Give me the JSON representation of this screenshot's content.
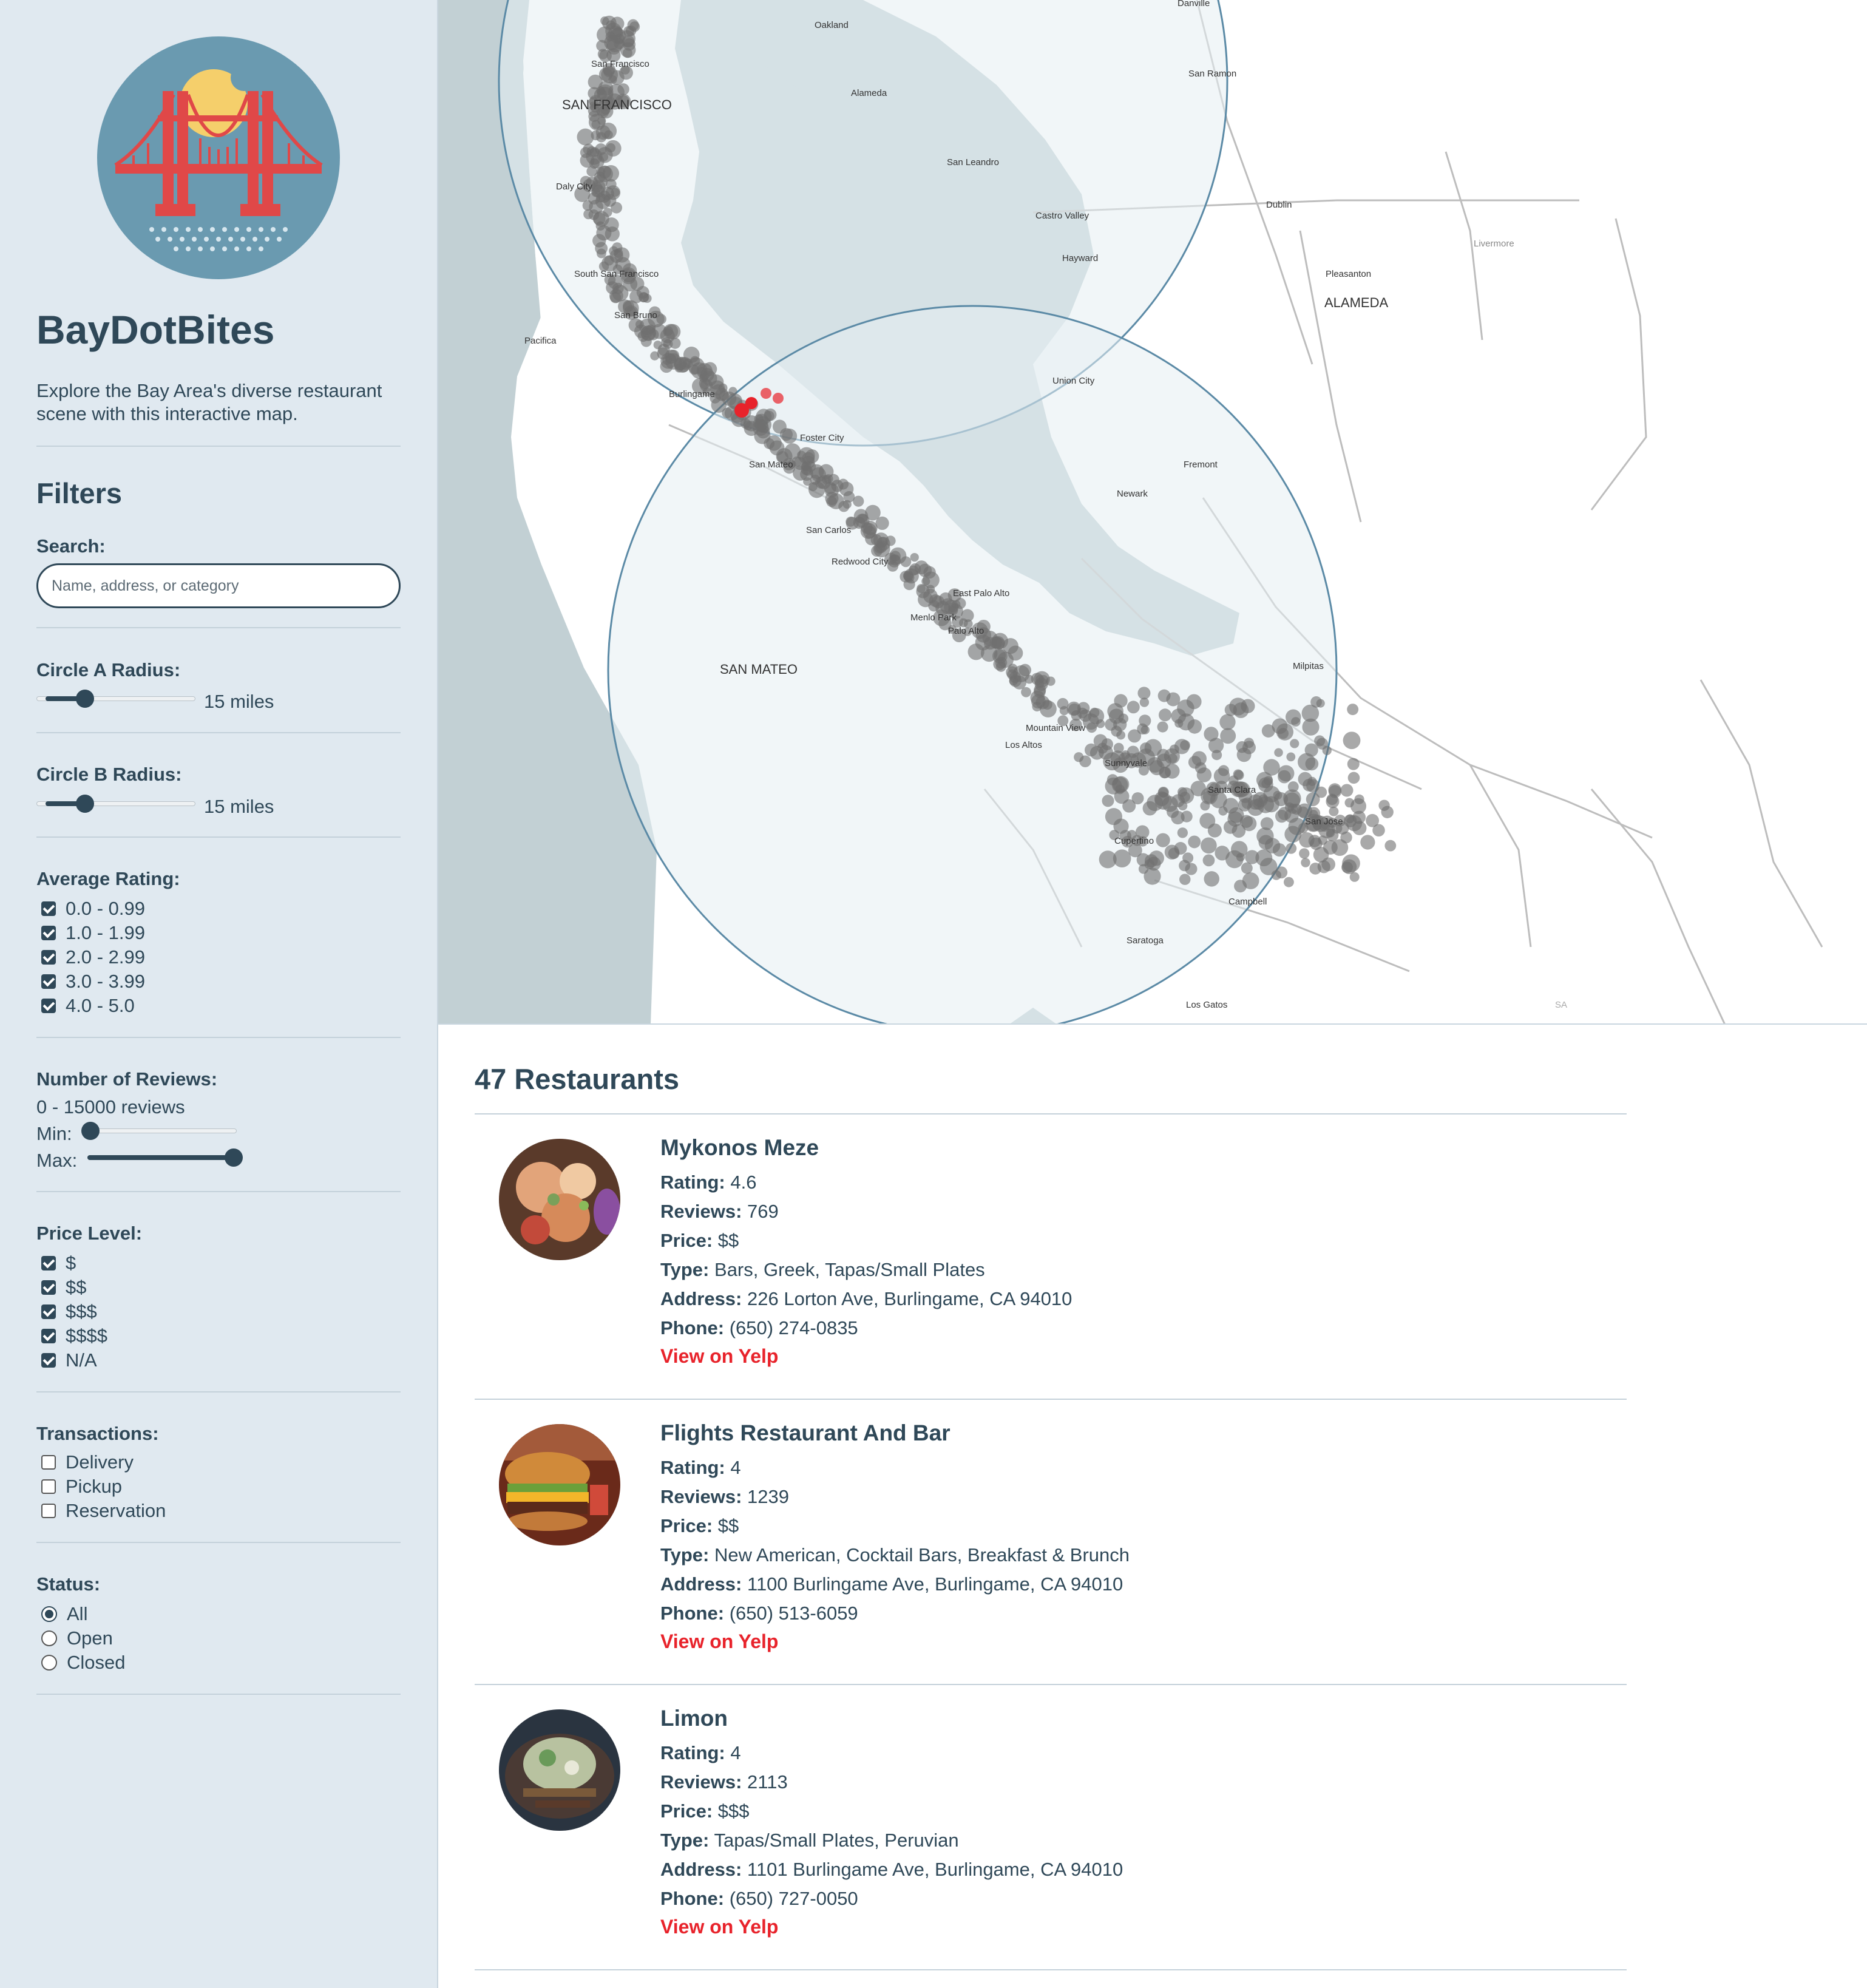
{
  "app": {
    "title": "BayDotBites",
    "description": "Explore the Bay Area's diverse restaurant scene with this interactive map."
  },
  "filters": {
    "title": "Filters",
    "search": {
      "label": "Search:",
      "placeholder": "Name, address, or category",
      "value": ""
    },
    "circle_a": {
      "label": "Circle A Radius:",
      "value_text": "15 miles",
      "fraction": 0.28
    },
    "circle_b": {
      "label": "Circle B Radius:",
      "value_text": "15 miles",
      "fraction": 0.28
    },
    "rating": {
      "label": "Average Rating:",
      "options": [
        {
          "label": "0.0 - 0.99",
          "checked": true
        },
        {
          "label": "1.0 - 1.99",
          "checked": true
        },
        {
          "label": "2.0 - 2.99",
          "checked": true
        },
        {
          "label": "3.0 - 3.99",
          "checked": true
        },
        {
          "label": "4.0 - 5.0",
          "checked": true
        }
      ]
    },
    "reviews": {
      "label": "Number of Reviews:",
      "range_text": "0 - 15000 reviews",
      "min_label": "Min:",
      "max_label": "Max:",
      "min_fraction": 0.0,
      "max_fraction": 1.0
    },
    "price": {
      "label": "Price Level:",
      "options": [
        {
          "label": "$",
          "checked": true
        },
        {
          "label": "$$",
          "checked": true
        },
        {
          "label": "$$$",
          "checked": true
        },
        {
          "label": "$$$$",
          "checked": true
        },
        {
          "label": "N/A",
          "checked": true
        }
      ]
    },
    "transactions": {
      "label": "Transactions:",
      "options": [
        {
          "label": "Delivery",
          "checked": false
        },
        {
          "label": "Pickup",
          "checked": false
        },
        {
          "label": "Reservation",
          "checked": false
        }
      ]
    },
    "status": {
      "label": "Status:",
      "options": [
        {
          "label": "All",
          "selected": true
        },
        {
          "label": "Open",
          "selected": false
        },
        {
          "label": "Closed",
          "selected": false
        }
      ]
    }
  },
  "map": {
    "labels": {
      "danville": "Danville",
      "oakland": "Oakland",
      "san_ramon": "San Ramon",
      "alameda": "Alameda",
      "san_francisco_small": "San Francisco",
      "san_francisco": "SAN FRANCISCO",
      "san_leandro": "San Leandro",
      "daly_city": "Daly City",
      "castro_valley": "Castro Valley",
      "dublin": "Dublin",
      "livermore": "Livermore",
      "hayward": "Hayward",
      "pleasanton": "Pleasanton",
      "alameda_county": "ALAMEDA",
      "south_sf": "South San Francisco",
      "san_bruno": "San Bruno",
      "pacifica": "Pacifica",
      "union_city": "Union City",
      "burlingame": "Burlingame",
      "foster_city": "Foster City",
      "fremont": "Fremont",
      "san_mateo": "San Mateo",
      "newark": "Newark",
      "san_carlos": "San Carlos",
      "redwood_city": "Redwood City",
      "east_palo_alto": "East Palo Alto",
      "menlo_park": "Menlo Park",
      "palo_alto": "Palo Alto",
      "san_mateo_county": "SAN MATEO",
      "milpitas": "Milpitas",
      "mountain_view": "Mountain View",
      "los_altos": "Los Altos",
      "sunnyvale": "Sunnyvale",
      "santa_clara": "Santa Clara",
      "san_jose": "San Jose",
      "cupertino": "Cupertino",
      "campbell": "Campbell",
      "saratoga": "Saratoga",
      "los_gatos": "Los Gatos",
      "sa": "SA"
    },
    "colors": {
      "water": "#c2d0d4",
      "land": "#ffffff",
      "circle_fill": "#e5eef3",
      "circle_stroke": "#5b8aa6",
      "marker": "#707070",
      "highlight": "#e8232b"
    }
  },
  "results": {
    "count_title": "47 Restaurants",
    "labels": {
      "rating": "Rating:",
      "reviews": "Reviews:",
      "price": "Price:",
      "type": "Type:",
      "address": "Address:",
      "phone": "Phone:",
      "link": "View on Yelp"
    },
    "items": [
      {
        "name": "Mykonos Meze",
        "rating": "4.6",
        "reviews": "769",
        "price": "$$",
        "type": "Bars, Greek, Tapas/Small Plates",
        "address": "226 Lorton Ave, Burlingame, CA 94010",
        "phone": "(650) 274-0835"
      },
      {
        "name": "Flights Restaurant And Bar",
        "rating": "4",
        "reviews": "1239",
        "price": "$$",
        "type": "New American, Cocktail Bars, Breakfast & Brunch",
        "address": "1100 Burlingame Ave, Burlingame, CA 94010",
        "phone": "(650) 513-6059"
      },
      {
        "name": "Limon",
        "rating": "4",
        "reviews": "2113",
        "price": "$$$",
        "type": "Tapas/Small Plates, Peruvian",
        "address": "1101 Burlingame Ave, Burlingame, CA 94010",
        "phone": "(650) 727-0050"
      }
    ]
  }
}
